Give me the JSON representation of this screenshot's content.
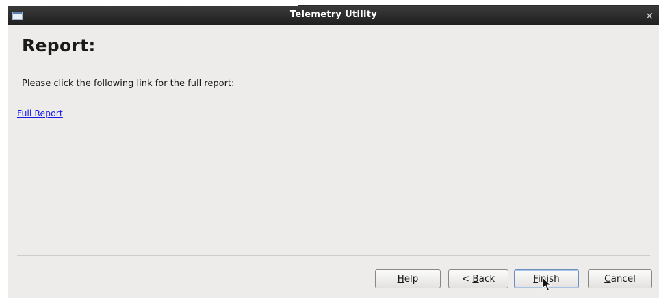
{
  "window": {
    "title": "Telemetry Utility",
    "close_glyph": "×"
  },
  "page": {
    "heading": "Report:",
    "description": "Please click the following link for the full report:",
    "link_text": "Full Report"
  },
  "buttons": {
    "help": {
      "mnemonic": "H",
      "rest": "elp"
    },
    "back": {
      "prefix": "< ",
      "mnemonic": "B",
      "rest": "ack"
    },
    "finish": {
      "mnemonic": "F",
      "rest": "inish"
    },
    "cancel": {
      "mnemonic": "C",
      "rest": "ancel"
    }
  },
  "icons": {
    "window_icon": "window-icon",
    "close_icon": "close-icon",
    "cursor": "mouse-pointer-icon"
  }
}
